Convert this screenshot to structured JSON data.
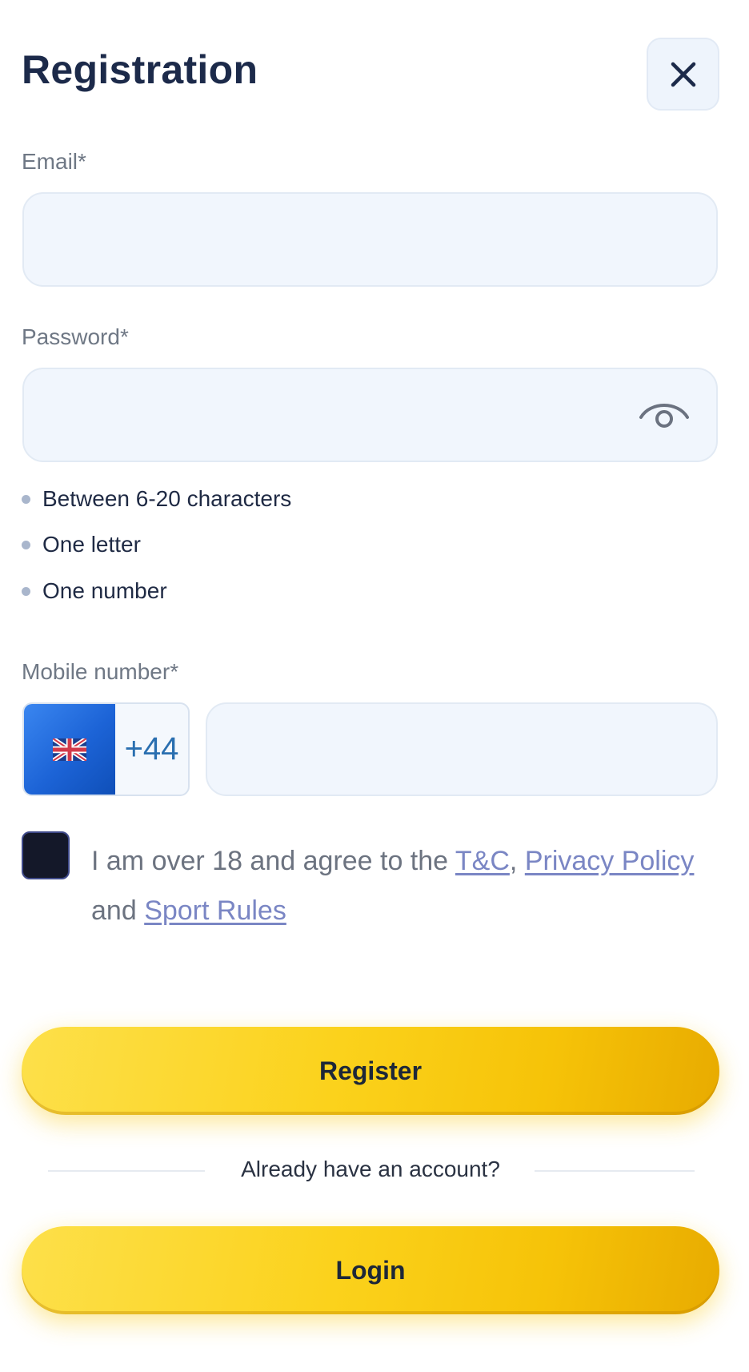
{
  "header": {
    "title": "Registration",
    "close_icon": "close-icon"
  },
  "email": {
    "label": "Email*",
    "value": "",
    "placeholder": ""
  },
  "password": {
    "label": "Password*",
    "value": "",
    "placeholder": "",
    "toggle_icon": "eye-icon"
  },
  "password_rules": [
    "Between 6-20 characters",
    "One letter",
    "One number"
  ],
  "mobile": {
    "label": "Mobile number*",
    "country_flag": "uk-flag-icon",
    "dial_code": "+44",
    "value": "",
    "placeholder": ""
  },
  "agreement": {
    "checked": false,
    "text_before": "I am over 18 and agree to the ",
    "tc_link": "T&C",
    "comma": ", ",
    "privacy_link": "Privacy Policy",
    "and_text": " and ",
    "sport_rules_link": "Sport Rules"
  },
  "actions": {
    "register_label": "Register",
    "divider_text": "Already have an account?",
    "login_label": "Login"
  },
  "colors": {
    "title": "#1c2a4a",
    "input_bg": "#f1f6fd",
    "button_yellow": "#fbd21c",
    "link": "#7a86c4",
    "checkbox": "#141829"
  }
}
